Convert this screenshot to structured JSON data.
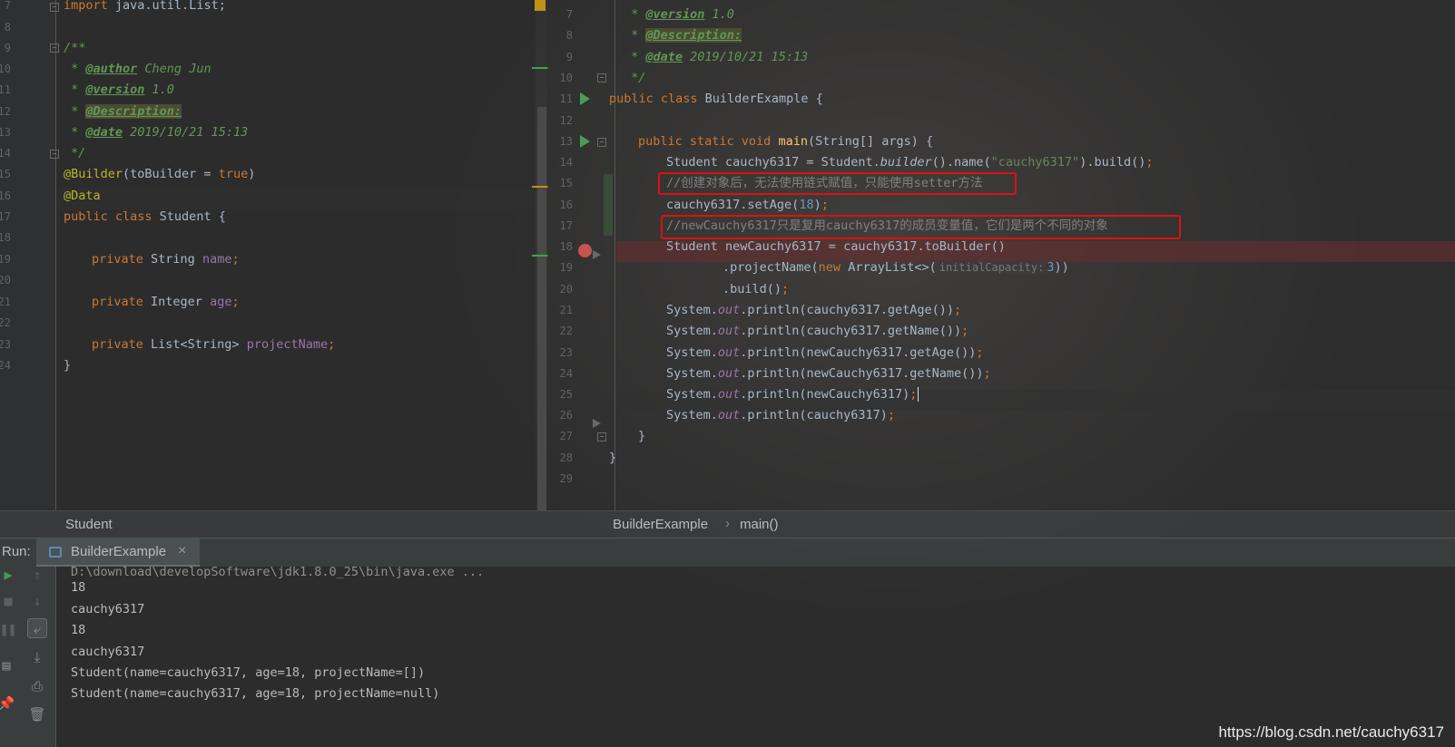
{
  "left_editor": {
    "line_numbers": [
      "7",
      "8",
      "9",
      "10",
      "11",
      "12",
      "13",
      "14",
      "15",
      "16",
      "17",
      "18",
      "19",
      "20",
      "21",
      "22",
      "23",
      "24"
    ],
    "import_kw": "import",
    "import_rest": " java.util.List;",
    "doc_open": "/**",
    "author_tag": "@author",
    "author_val": " Cheng Jun",
    "version_tag": "@version",
    "version_val": " 1.0",
    "desc_tag": "@Description:",
    "date_tag": "@date",
    "date_val": " 2019/10/21 15:13",
    "doc_close": "*/",
    "ann_builder": "@Builder",
    "ann_builder_args_open": "(toBuilder = ",
    "ann_builder_true": "true",
    "ann_builder_args_close": ")",
    "ann_data": "@Data",
    "class_decl_kw": "public class",
    "class_decl_name": " Student {",
    "field1_kw": "private",
    "field1_type": " String ",
    "field1_name": "name",
    "field2_kw": "private",
    "field2_type": " Integer ",
    "field2_name": "age",
    "field3_kw": "private",
    "field3_type": " List<String> ",
    "field3_name": "projectName",
    "semi": ";",
    "doc_star": " * ",
    "close_brace": "}"
  },
  "right_editor": {
    "line_numbers": [
      "7",
      "8",
      "9",
      "10",
      "11",
      "12",
      "13",
      "14",
      "15",
      "16",
      "17",
      "18",
      "19",
      "20",
      "21",
      "22",
      "23",
      "24",
      "25",
      "26",
      "27",
      "28",
      "29"
    ],
    "version_tag": "@version",
    "version_val": " 1.0",
    "desc_tag": "@Description:",
    "date_tag": "@date",
    "date_val": " 2019/10/21 15:13",
    "doc_star": " * ",
    "doc_close": " */",
    "class_kw": "public class",
    "class_name": " BuilderExample {",
    "main_kw": "public static void",
    "main_name": " main",
    "main_params": "(String[] args) {",
    "l14_a": "Student cauchy6317 = Student.",
    "l14_builder": "builder",
    "l14_b": "().name(",
    "l14_str": "\"cauchy6317\"",
    "l14_c": ").build()",
    "l15_comment": "//创建对象后，无法使用链式赋值，只能使用setter方法",
    "l16_a": "cauchy6317.setAge(",
    "l16_num": "18",
    "l16_b": ")",
    "l17_comment": "//newCauchy6317只是复用cauchy6317的成员变量值，它们是两个不同的对象",
    "l18": "Student newCauchy6317 = cauchy6317.toBuilder()",
    "l19_a": ".projectName(",
    "l19_new": "new",
    "l19_b": " ArrayList<>(",
    "l19_hint": "initialCapacity:",
    "l19_num": "3",
    "l19_c": "))",
    "l20": ".build()",
    "sys": "System.",
    "out": "out",
    "semi": ";",
    "l21": ".println(cauchy6317.getAge())",
    "l22": ".println(cauchy6317.getName())",
    "l23": ".println(newCauchy6317.getAge())",
    "l24": ".println(newCauchy6317.getName())",
    "l25": ".println(newCauchy6317)",
    "l26": ".println(cauchy6317)",
    "l27": "}",
    "l28": "}"
  },
  "breadcrumbs": {
    "left": "Student",
    "right_class": "BuilderExample",
    "right_sep": "›",
    "right_method": "main()"
  },
  "run": {
    "label": "Run:",
    "tab_title": "BuilderExample",
    "tab_close": "×"
  },
  "console": {
    "command": "D:\\download\\developSoftware\\jdk1.8.0_25\\bin\\java.exe ...",
    "lines": [
      "18",
      "cauchy6317",
      "18",
      "cauchy6317",
      "Student(name=cauchy6317, age=18, projectName=[])",
      "Student(name=cauchy6317, age=18, projectName=null)"
    ]
  },
  "watermark": "https://blog.csdn.net/cauchy6317"
}
